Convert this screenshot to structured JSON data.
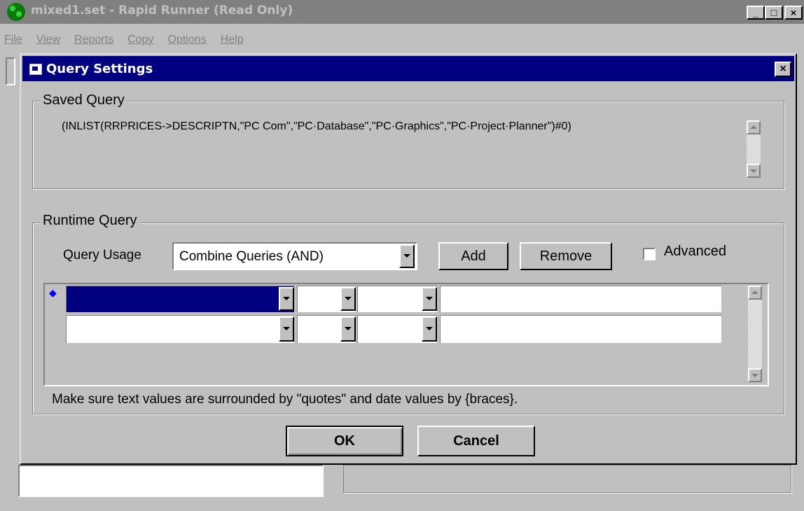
{
  "app": {
    "title": "mixed1.set - Rapid Runner (Read Only)",
    "menu": [
      "File",
      "View",
      "Reports",
      "Copy",
      "Options",
      "Help"
    ]
  },
  "dialog": {
    "title": "Query Settings",
    "saved_query": {
      "label": "Saved Query",
      "text": "(INLIST(RRPRICES->DESCRIPTN,\"PC Com\",\"PC·Database\",\"PC·Graphics\",\"PC·Project·Planner\")#0)"
    },
    "runtime_query": {
      "label": "Runtime Query",
      "usage_label": "Query Usage",
      "usage_value": "Combine Queries (AND)",
      "add_label": "Add",
      "remove_label": "Remove",
      "advanced_label": "Advanced",
      "advanced_checked": false,
      "row_marker": "◆",
      "hint": "Make sure text values are surrounded by \"quotes\" and date values by {braces}."
    },
    "ok_label": "OK",
    "cancel_label": "Cancel"
  },
  "colors": {
    "title_active": "#000080",
    "title_inactive": "#808080",
    "face": "#c0c0c0",
    "marker": "#0000ff"
  }
}
